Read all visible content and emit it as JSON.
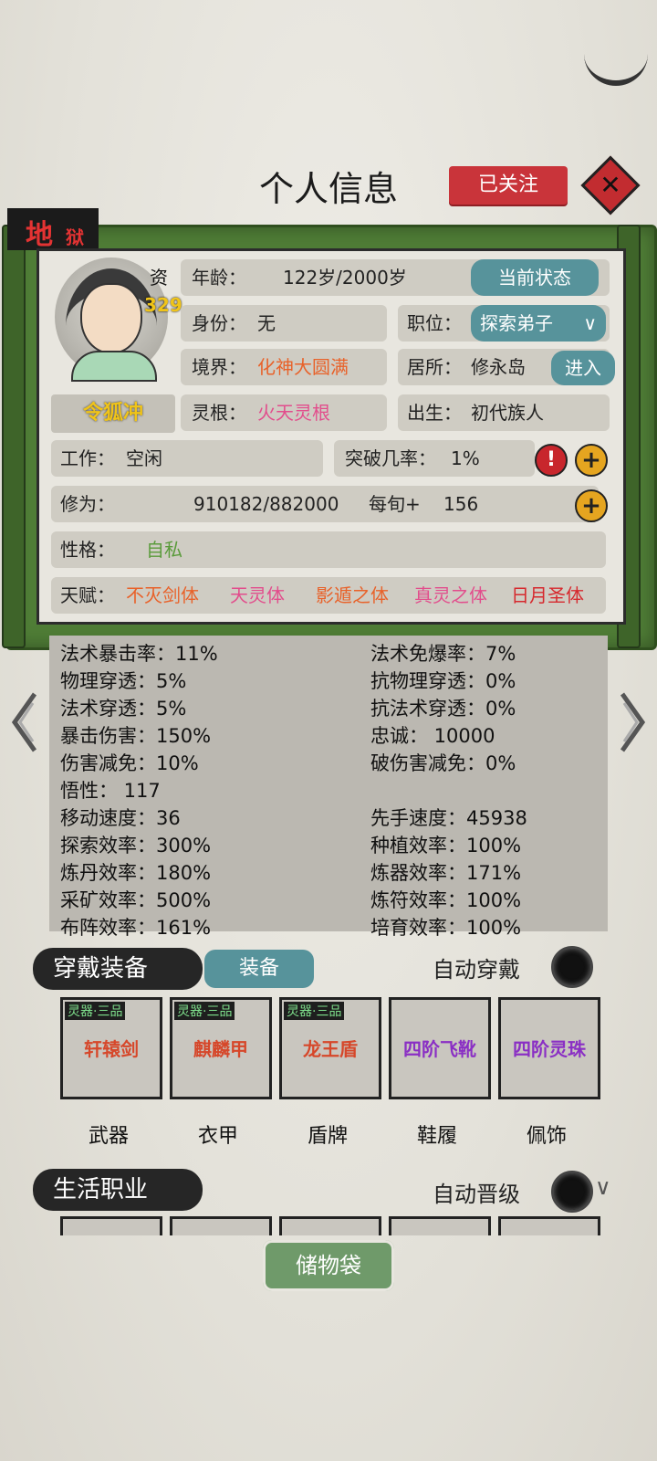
{
  "header": {
    "title": "个人信息",
    "follow_label": "已关注",
    "close_icon": "✕"
  },
  "difficulty": {
    "big": "地",
    "small": "狱"
  },
  "character": {
    "zi_label": "资",
    "zi_value": "329",
    "name": "令狐冲",
    "age_label": "年龄：",
    "age_value": "122岁/2000岁",
    "status_button": "当前状态",
    "identity_label": "身份：",
    "identity_value": "无",
    "position_label": "职位：",
    "position_value": "探索弟子",
    "realm_label": "境界：",
    "realm_value": "化神大圆满",
    "residence_label": "居所：",
    "residence_value": "修永岛",
    "enter_button": "进入",
    "root_label": "灵根：",
    "root_value": "火天灵根",
    "birth_label": "出生：",
    "birth_value": "初代族人",
    "work_label": "工作：",
    "work_value": "空闲",
    "breakthrough_label": "突破几率：",
    "breakthrough_value": "1%",
    "cultivation_label": "修为：",
    "cultivation_value": "910182/882000",
    "per_turn_label": "每旬+",
    "per_turn_value": "156",
    "personality_label": "性格：",
    "personality_value": "自私",
    "talent_label": "天赋：",
    "talents": [
      "不灭剑体",
      "天灵体",
      "影遁之体",
      "真灵之体",
      "日月圣体"
    ]
  },
  "stats": [
    {
      "left": "法术暴击率：11%",
      "right": "法术免爆率：7%"
    },
    {
      "left": "物理穿透：5%",
      "right": "抗物理穿透：0%"
    },
    {
      "left": "法术穿透：5%",
      "right": "抗法术穿透：0%"
    },
    {
      "left": "暴击伤害：150%",
      "right": "忠诚：  10000"
    },
    {
      "left": "伤害减免：10%",
      "right": "破伤害减免：0%"
    },
    {
      "left": "悟性：  117",
      "right": ""
    },
    {
      "left": "移动速度：36",
      "right": "先手速度：45938"
    },
    {
      "left": "探索效率：300%",
      "right": "种植效率：100%"
    },
    {
      "left": "炼丹效率：180%",
      "right": "炼器效率：171%"
    },
    {
      "left": "采矿效率：500%",
      "right": "炼符效率：100%"
    },
    {
      "left": "布阵效率：161%",
      "right": "培育效率：100%"
    }
  ],
  "equipment": {
    "section_title": "穿戴装备",
    "equip_button": "装备",
    "auto_label": "自动穿戴",
    "slots": [
      {
        "grade": "灵器·三品",
        "item": "轩辕剑",
        "label": "武器",
        "color": "#d6472a"
      },
      {
        "grade": "灵器·三品",
        "item": "麒麟甲",
        "label": "衣甲",
        "color": "#d6472a"
      },
      {
        "grade": "灵器·三品",
        "item": "龙王盾",
        "label": "盾牌",
        "color": "#d6472a"
      },
      {
        "grade": "",
        "item": "四阶飞靴",
        "label": "鞋履",
        "color": "#8a2fc4"
      },
      {
        "grade": "",
        "item": "四阶灵珠",
        "label": "佩饰",
        "color": "#8a2fc4"
      }
    ]
  },
  "life": {
    "section_title": "生活职业",
    "auto_label": "自动晋级"
  },
  "bag_button": "储物袋"
}
